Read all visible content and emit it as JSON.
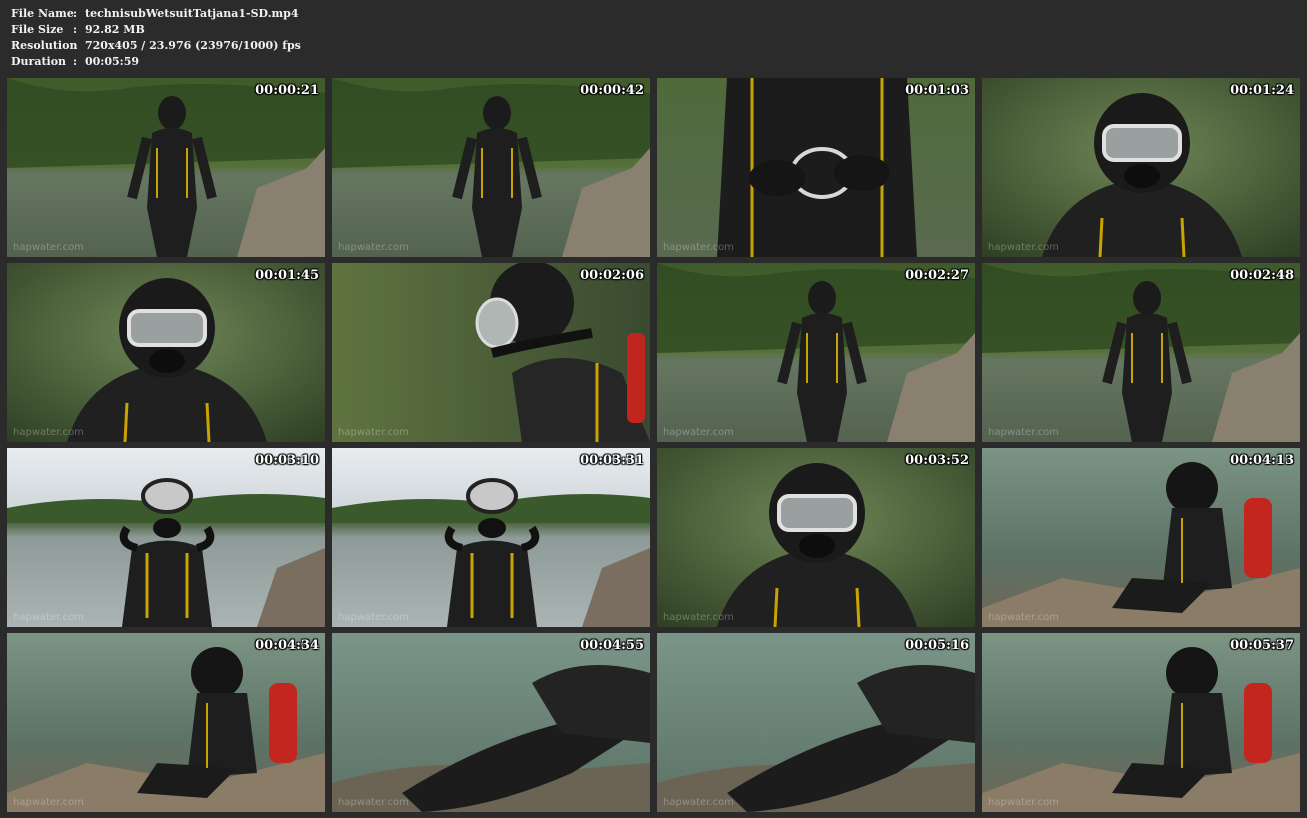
{
  "file_info": {
    "name_label": "File Name",
    "name_value": "technisubWetsuitTatjana1-SD.mp4",
    "size_label": "File Size",
    "size_value": "92.82 MB",
    "resolution_label": "Resolution",
    "resolution_value": "720x405 / 23.976 (23976/1000) fps",
    "duration_label": "Duration",
    "duration_value": "00:05:59",
    "separator": ":"
  },
  "thumbnails": [
    {
      "timestamp": "00:00:21",
      "scene": "lake-standing"
    },
    {
      "timestamp": "00:00:42",
      "scene": "lake-standing"
    },
    {
      "timestamp": "00:01:03",
      "scene": "closeup-torso"
    },
    {
      "timestamp": "00:01:24",
      "scene": "closeup-mask"
    },
    {
      "timestamp": "00:01:45",
      "scene": "closeup-mask"
    },
    {
      "timestamp": "00:02:06",
      "scene": "profile-mask"
    },
    {
      "timestamp": "00:02:27",
      "scene": "lake-standing"
    },
    {
      "timestamp": "00:02:48",
      "scene": "lake-standing"
    },
    {
      "timestamp": "00:03:10",
      "scene": "lake-bright"
    },
    {
      "timestamp": "00:03:31",
      "scene": "lake-bright"
    },
    {
      "timestamp": "00:03:52",
      "scene": "closeup-mask"
    },
    {
      "timestamp": "00:04:13",
      "scene": "water-rocks"
    },
    {
      "timestamp": "00:04:34",
      "scene": "water-rocks"
    },
    {
      "timestamp": "00:04:55",
      "scene": "water-legs"
    },
    {
      "timestamp": "00:05:16",
      "scene": "water-legs"
    },
    {
      "timestamp": "00:05:37",
      "scene": "water-rocks"
    }
  ],
  "watermark": "hapwater.com",
  "colors": {
    "background": "#2b2b2b",
    "header_text": "#f2f2f2",
    "timestamp_text": "#ffffff"
  }
}
